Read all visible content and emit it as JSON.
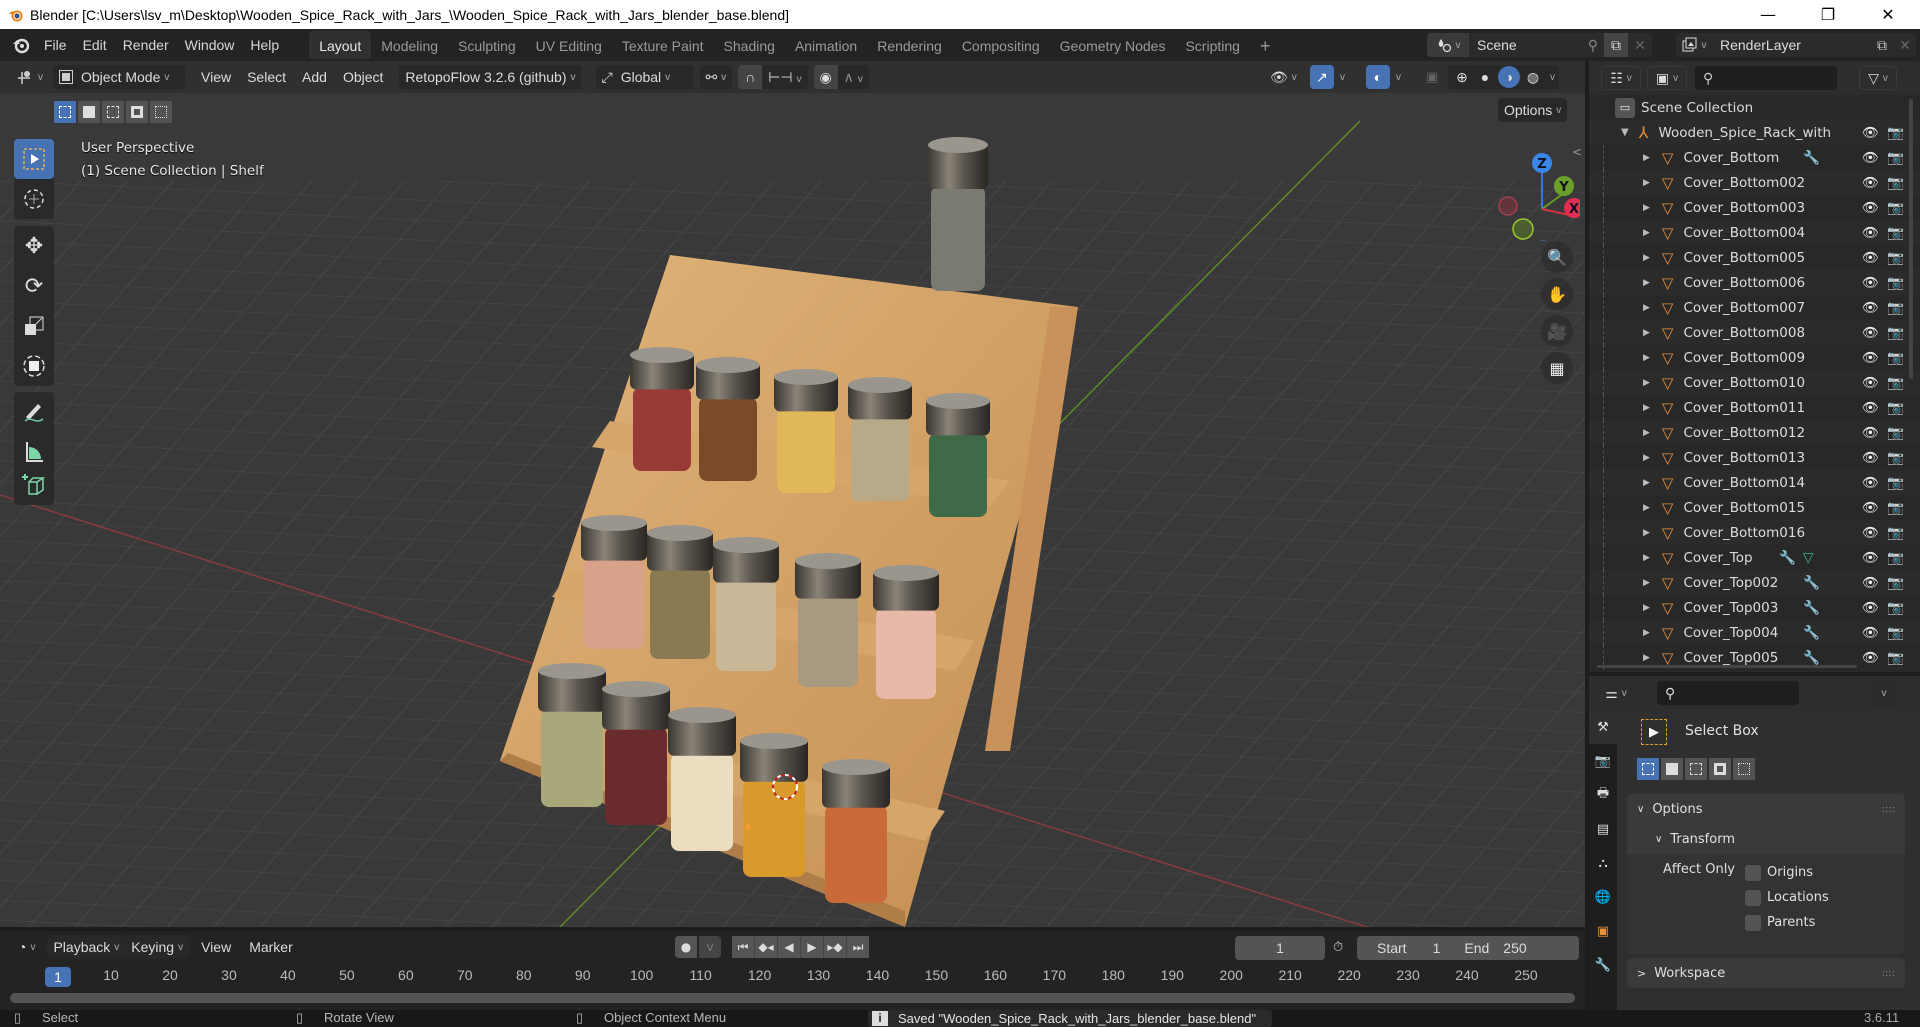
{
  "window": {
    "title": "Blender [C:\\Users\\lsv_m\\Desktop\\Wooden_Spice_Rack_with_Jars_\\Wooden_Spice_Rack_with_Jars_blender_base.blend]",
    "minimize": "—",
    "maximize": "❐",
    "close": "✕"
  },
  "menubar": {
    "items": [
      "File",
      "Edit",
      "Render",
      "Window",
      "Help"
    ],
    "workspaces": [
      "Layout",
      "Modeling",
      "Sculpting",
      "UV Editing",
      "Texture Paint",
      "Shading",
      "Animation",
      "Rendering",
      "Compositing",
      "Geometry Nodes",
      "Scripting"
    ],
    "active_workspace": "Layout",
    "add_workspace": "+",
    "scene": "Scene",
    "view_layer": "RenderLayer"
  },
  "viewport_header": {
    "mode": "Object Mode",
    "menus": [
      "View",
      "Select",
      "Add",
      "Object"
    ],
    "addon": "RetopoFlow 3.2.6 (github)",
    "orientation": "Global",
    "options_label": "Options"
  },
  "viewport": {
    "perspective": "User Perspective",
    "context": "(1) Scene Collection | Shelf",
    "gizmo_axes": [
      "X",
      "Y",
      "Z"
    ],
    "tools": [
      "select-box",
      "cursor",
      "move",
      "rotate",
      "scale",
      "transform",
      "annotate",
      "measure",
      "add-cube"
    ],
    "scene": {
      "object_name": "Wooden Spice Rack with Jars",
      "jar_colors": {
        "top": [
          "#9a3a36",
          "#7a4a2a",
          "#e0b85a",
          "#b8aa88",
          "#3f6a48"
        ],
        "middle": [
          "#d9a08a",
          "#8a7a52",
          "#c8b898",
          "#a89a80",
          "#e8b8a8"
        ],
        "bottom": [
          "#a8a87a",
          "#6a2a2e",
          "#ecdcc0",
          "#d89a2a",
          "#c86a3a"
        ],
        "floating": "#7a7a72"
      }
    }
  },
  "outliner": {
    "root": "Scene Collection",
    "collection": "Wooden_Spice_Rack_with",
    "items": [
      {
        "name": "Cover_Bottom",
        "modifier": true,
        "selected_data": false
      },
      {
        "name": "Cover_Bottom002",
        "modifier": false,
        "selected_data": false
      },
      {
        "name": "Cover_Bottom003",
        "modifier": false,
        "selected_data": false
      },
      {
        "name": "Cover_Bottom004",
        "modifier": false,
        "selected_data": false
      },
      {
        "name": "Cover_Bottom005",
        "modifier": false,
        "selected_data": false
      },
      {
        "name": "Cover_Bottom006",
        "modifier": false,
        "selected_data": false
      },
      {
        "name": "Cover_Bottom007",
        "modifier": false,
        "selected_data": false
      },
      {
        "name": "Cover_Bottom008",
        "modifier": false,
        "selected_data": false
      },
      {
        "name": "Cover_Bottom009",
        "modifier": false,
        "selected_data": false
      },
      {
        "name": "Cover_Bottom010",
        "modifier": false,
        "selected_data": false
      },
      {
        "name": "Cover_Bottom011",
        "modifier": false,
        "selected_data": false
      },
      {
        "name": "Cover_Bottom012",
        "modifier": false,
        "selected_data": false
      },
      {
        "name": "Cover_Bottom013",
        "modifier": false,
        "selected_data": false
      },
      {
        "name": "Cover_Bottom014",
        "modifier": false,
        "selected_data": false
      },
      {
        "name": "Cover_Bottom015",
        "modifier": false,
        "selected_data": false
      },
      {
        "name": "Cover_Bottom016",
        "modifier": false,
        "selected_data": false
      },
      {
        "name": "Cover_Top",
        "modifier": true,
        "selected_data": true
      },
      {
        "name": "Cover_Top002",
        "modifier": true,
        "selected_data": false
      },
      {
        "name": "Cover_Top003",
        "modifier": true,
        "selected_data": false
      },
      {
        "name": "Cover_Top004",
        "modifier": true,
        "selected_data": false
      },
      {
        "name": "Cover_Top005",
        "modifier": true,
        "selected_data": false
      }
    ]
  },
  "properties": {
    "tool_name": "Select Box",
    "options_label": "Options",
    "transform_label": "Transform",
    "affect_only_label": "Affect Only",
    "checkboxes": [
      {
        "label": "Origins",
        "checked": false
      },
      {
        "label": "Locations",
        "checked": false
      },
      {
        "label": "Parents",
        "checked": false
      }
    ],
    "workspace_label": "Workspace"
  },
  "timeline": {
    "menus": [
      "Playback",
      "Keying",
      "View",
      "Marker"
    ],
    "current_frame": "1",
    "start_label": "Start",
    "start": "1",
    "end_label": "End",
    "end": "250",
    "ruler": [
      "10",
      "20",
      "30",
      "40",
      "50",
      "60",
      "70",
      "80",
      "90",
      "100",
      "110",
      "120",
      "130",
      "140",
      "150",
      "160",
      "170",
      "180",
      "190",
      "200",
      "210",
      "220",
      "230",
      "240",
      "250"
    ],
    "playhead": "1"
  },
  "statusbar": {
    "select": "Select",
    "rotate": "Rotate View",
    "context_menu": "Object Context Menu",
    "message": "Saved \"Wooden_Spice_Rack_with_Jars_blender_base.blend\"",
    "version": "3.6.11"
  }
}
